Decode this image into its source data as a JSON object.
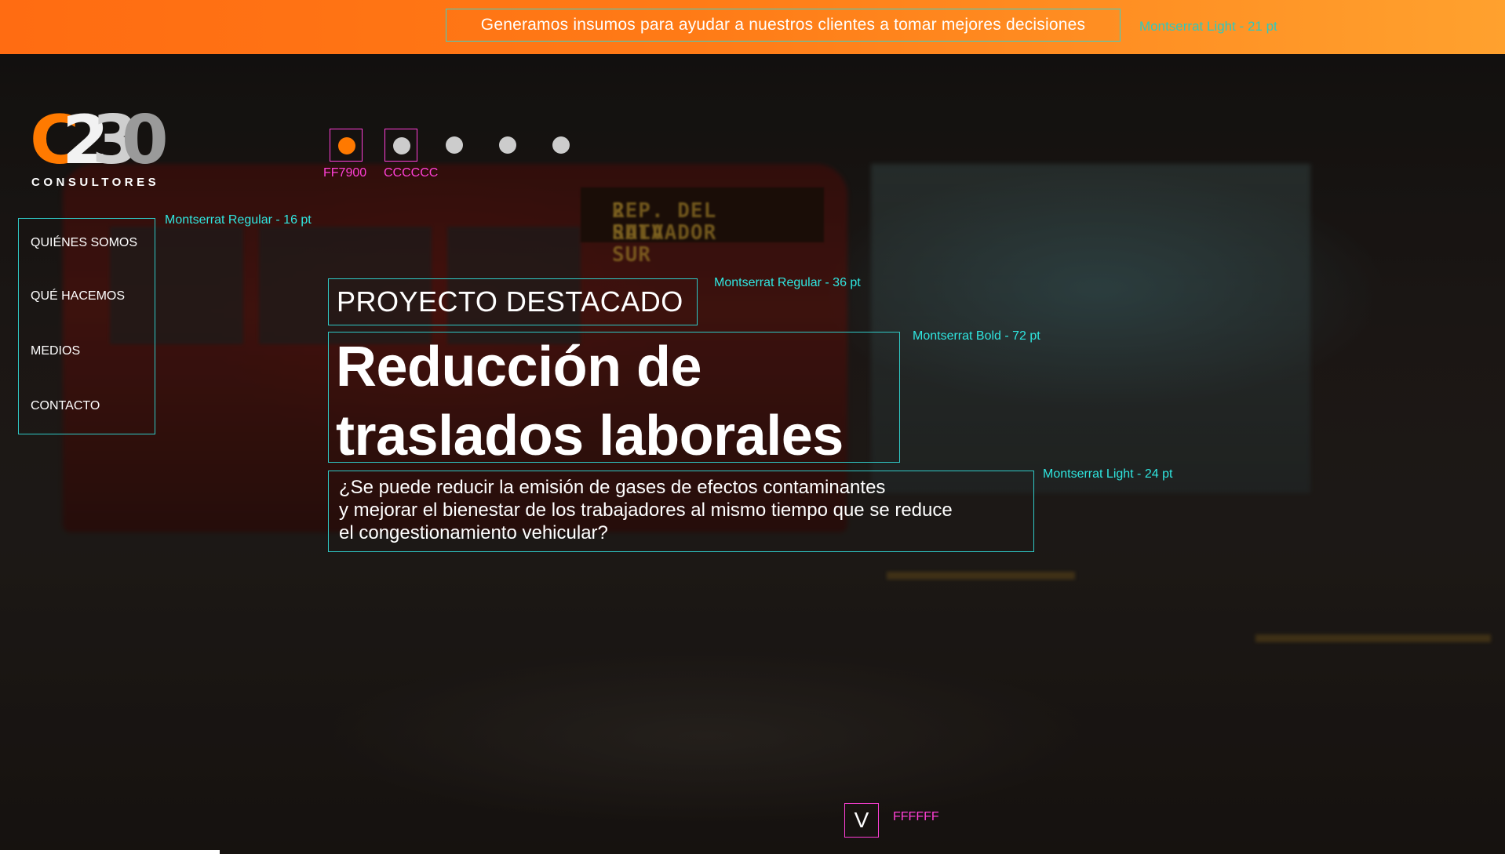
{
  "banner": {
    "tagline": "Generamos insumos para ayudar a nuestros clientes a tomar mejores decisiones",
    "tagline_spec": "Montserrat Light - 21 pt"
  },
  "logo": {
    "mark": [
      "C",
      "2",
      "3",
      "0"
    ],
    "subtitle": "CONSULTORES"
  },
  "slider": {
    "dots": [
      {
        "color": "#FF7900",
        "label": "FF7900",
        "active": true
      },
      {
        "color": "#CCCCCC",
        "label": "CCCCCC",
        "active": false
      },
      {
        "color": "#CCCCCC",
        "label": "",
        "active": false
      },
      {
        "color": "#CCCCCC",
        "label": "",
        "active": false
      },
      {
        "color": "#CCCCCC",
        "label": "",
        "active": false
      }
    ]
  },
  "menu": {
    "spec": "Montserrat Regular - 16 pt",
    "items": [
      {
        "label": "QUIÉNES SOMOS"
      },
      {
        "label": "QUÉ HACEMOS"
      },
      {
        "label": "MEDIOS"
      },
      {
        "label": "CONTACTO"
      }
    ]
  },
  "hero": {
    "kicker": "PROYECTO DESTACADO",
    "kicker_spec": "Montserrat Regular - 36 pt",
    "headline_lines": [
      "Reducción de",
      "traslados laborales"
    ],
    "headline_spec": "Montserrat Bold - 72 pt",
    "question_lines": [
      "¿Se puede reducir la emisión de gases de efectos contaminantes",
      "y mejorar el bienestar de los trabajadores al mismo tiempo que se reduce",
      "el congestionamiento vehicular?"
    ],
    "question_spec": "Montserrat Light - 24 pt",
    "photo_sign_lines": [
      "2 RUTA SUR",
      "REP. DEL SALVADOR"
    ]
  },
  "scroll": {
    "icon": "chevron-down-icon",
    "glyph": "V",
    "spec": "FFFFFF"
  },
  "colors": {
    "accent": "#FF7900",
    "secondary": "#CCCCCC",
    "text": "#FFFFFF",
    "spec_cyan": "#2FE6E0",
    "spec_magenta": "#FF3FD6"
  }
}
